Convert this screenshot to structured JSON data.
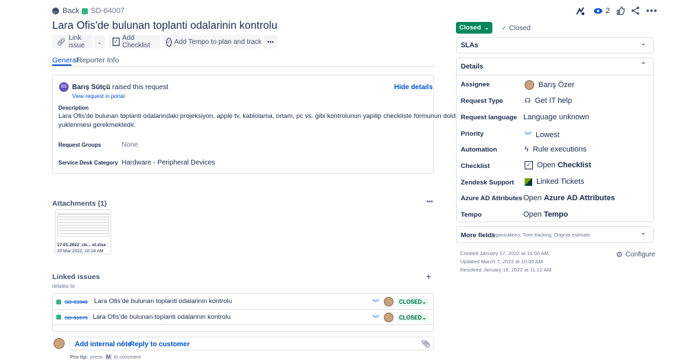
{
  "header": {
    "back_label": "Back",
    "issue_key": "SD-64007",
    "watch_count": "2",
    "title": "Lara Ofis'de bulunan toplanti odalarinin kontrolu"
  },
  "toolbar": {
    "link_issue": "Link issue",
    "add_checklist": "Add Checklist",
    "add_tempo": "Add Tempo to plan and track time"
  },
  "tabs": [
    "General",
    "Reporter Info"
  ],
  "request": {
    "reporter_initials": "BS",
    "reporter": "Barış Sütçü",
    "raised_text": "raised this request",
    "view_portal": "View request in portal",
    "hide_details": "Hide details",
    "description_label": "Description",
    "description_line1": "Lara Ofis'de bulunan toplanti odalarindaki projeksiyon, apple tv, kablolama, ortam, pc vs. gibi kontrolunun yapilip checkliste formunun doldurulmus sekilde",
    "description_line2": "yuklenmesi gerekmektedir.",
    "request_groups_label": "Request Groups",
    "request_groups_value": "None",
    "category_label": "Service Desk Category",
    "category_value": "Hardware - Peripheral Devices"
  },
  "attachments": {
    "heading": "Attachments (1)",
    "file_name": "17.01.2022_ch... st.xlsx",
    "file_date": "20 Mar 2022, 10:14 AM"
  },
  "linked": {
    "heading": "Linked issues",
    "relation": "relates to",
    "items": [
      {
        "key": "SD-63346",
        "summary": "Lara Ofis'de bulunan toplanti odalarinin kontrolu",
        "status": "CLOSED"
      },
      {
        "key": "SD-61679",
        "summary": "Lara Ofis'de bulunan toplanti odalarinin kontrolu",
        "status": "CLOSED"
      }
    ]
  },
  "comment": {
    "add_internal": "Add internal note",
    "separator": "/",
    "reply": "Reply to customer",
    "pro_tip": "Pro tip:",
    "press": "press",
    "key": "M",
    "to_comment": "to comment"
  },
  "sidebar": {
    "status_button": "Closed",
    "status_text": "Closed",
    "slas": "SLAs",
    "details": "Details",
    "fields": [
      {
        "label": "Assignee",
        "value": "Barış Özer",
        "icon": "avatar-icon"
      },
      {
        "label": "Request Type",
        "value": "Get IT help",
        "icon": "headset-icon"
      },
      {
        "label": "Request language",
        "value": "Language unknown",
        "icon": ""
      },
      {
        "label": "Priority",
        "value": "Lowest",
        "icon": "priority-lowest-icon"
      },
      {
        "label": "Automation",
        "value": "Rule executions",
        "icon": "lightning-icon"
      },
      {
        "label": "Checklist",
        "value_prefix": "Open",
        "value_bold": "Checklist",
        "icon": "checklist-icon"
      },
      {
        "label": "Zendesk Support",
        "value": "Linked Tickets",
        "icon": "zendesk-icon"
      },
      {
        "label": "Azure AD Attributes",
        "value_prefix": "Open",
        "value_bold": "Azure AD Attributes",
        "icon": ""
      },
      {
        "label": "Tempo",
        "value_prefix": "Open",
        "value_bold": "Tempo",
        "icon": ""
      }
    ],
    "more_fields": "More fields",
    "more_fields_sub": "Organizations, Time tracking, Original estimate",
    "created": "Created January 17, 2022 at 10:00 AM",
    "updated": "Updated March 7, 2022 at 10:00 AM",
    "resolved": "Resolved January 19, 2022 at 11:12 AM",
    "configure": "Configure"
  },
  "colors": {
    "primary": "#0052cc",
    "status_green": "#00875a",
    "lozenge_green": "#006644"
  }
}
